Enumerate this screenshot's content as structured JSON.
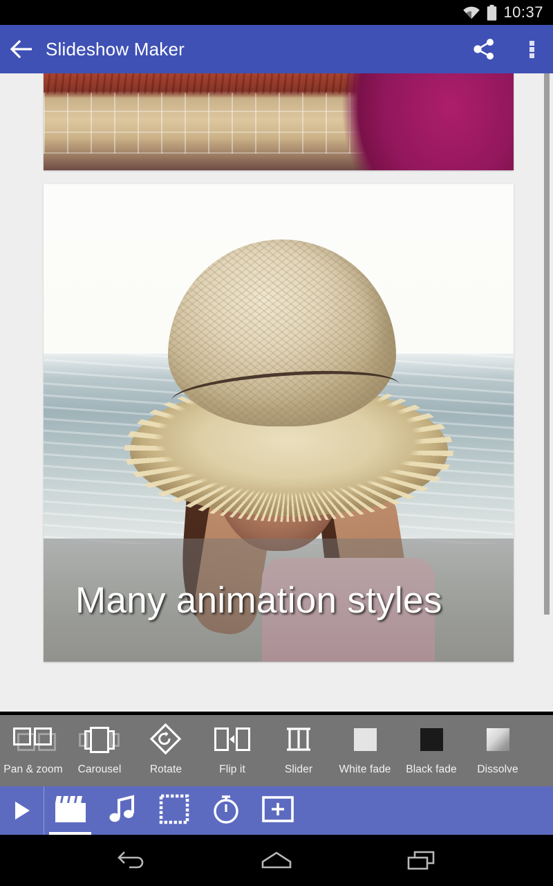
{
  "status_bar": {
    "time": "10:37",
    "wifi_icon": "wifi-icon",
    "battery_icon": "battery-icon"
  },
  "app_bar": {
    "title": "Slideshow Maker",
    "back_icon": "back-arrow-icon",
    "share_icon": "share-icon",
    "overflow_icon": "overflow-menu-icon",
    "background_color": "#3f51b5"
  },
  "content": {
    "slides": [
      {
        "name": "slide-previous",
        "caption": ""
      },
      {
        "name": "slide-current",
        "caption": "Many animation styles"
      }
    ],
    "caption": "Many animation styles",
    "scrollbar": "vertical-scrollbar"
  },
  "styles_bar": {
    "background_color": "#757575",
    "items": [
      {
        "label": "Pan & zoom",
        "icon": "pan-and-zoom-icon"
      },
      {
        "label": "Carousel",
        "icon": "carousel-icon"
      },
      {
        "label": "Rotate",
        "icon": "rotate-icon"
      },
      {
        "label": "Flip it",
        "icon": "flip-it-icon"
      },
      {
        "label": "Slider",
        "icon": "slider-icon"
      },
      {
        "label": "White fade",
        "icon": "white-fade-icon",
        "color": "#e4e4e4"
      },
      {
        "label": "Black fade",
        "icon": "black-fade-icon",
        "color": "#1a1a1a"
      },
      {
        "label": "Dissolve",
        "icon": "dissolve-icon"
      }
    ]
  },
  "bottom_toolbar": {
    "background_color": "#5c6bc0",
    "play_icon": "play-icon",
    "items": [
      {
        "icon": "clapperboard-icon",
        "selected": true
      },
      {
        "icon": "music-note-icon",
        "selected": false
      },
      {
        "icon": "frame-border-icon",
        "selected": false
      },
      {
        "icon": "timer-icon",
        "selected": false
      },
      {
        "icon": "add-box-icon",
        "selected": false
      }
    ]
  },
  "nav_bar": {
    "back_icon": "android-back-icon",
    "home_icon": "android-home-icon",
    "recents_icon": "android-recents-icon"
  }
}
